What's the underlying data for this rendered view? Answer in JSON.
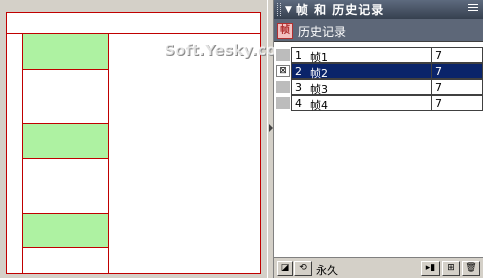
{
  "panel": {
    "title": "帧 和 历史记录",
    "collapse_icon": "▼",
    "menu_icon": "panel-options-icon"
  },
  "tabs": {
    "history_label": "历史记录",
    "history_icon_glyph": "帧"
  },
  "watermark": "Soft.Yesky.com",
  "frames": [
    {
      "num": "1",
      "label": "帧1",
      "delay": "7",
      "checked": false,
      "selected": false
    },
    {
      "num": "2",
      "label": "帧2",
      "delay": "7",
      "checked": true,
      "selected": true
    },
    {
      "num": "3",
      "label": "帧3",
      "delay": "7",
      "checked": false,
      "selected": false
    },
    {
      "num": "4",
      "label": "帧4",
      "delay": "7",
      "checked": false,
      "selected": false
    }
  ],
  "bottom_bar": {
    "looping_label": "永久",
    "onion_icon": "onion-skin-icon",
    "loop_icon": "loop-icon",
    "distribute_icon": "distribute-to-frames-icon",
    "new_frame_icon": "new-frame-icon",
    "delete_icon": "trash-icon"
  },
  "colors": {
    "grid_line": "#c00000",
    "cell_fill": "#aef2a2",
    "selection": "#0a246a",
    "titlebar": "#36404f"
  }
}
